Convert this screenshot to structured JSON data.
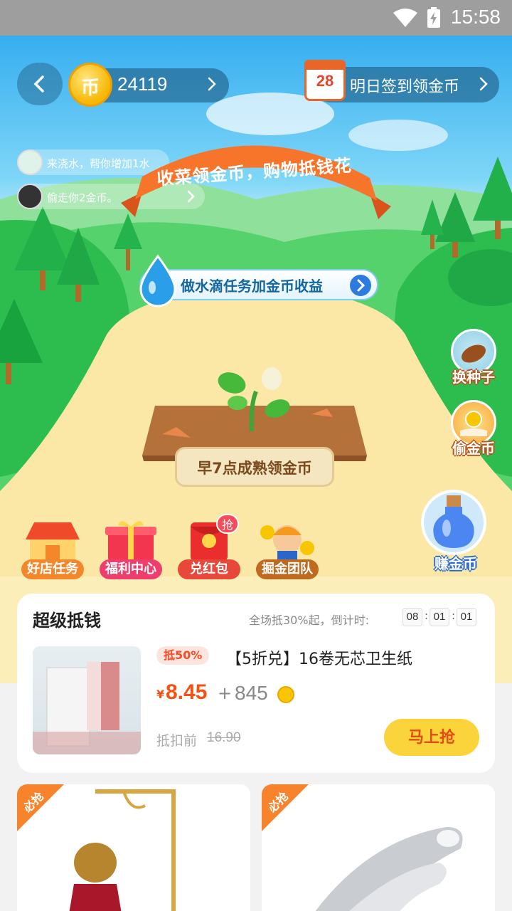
{
  "status_bar": {
    "time": "15:58",
    "icons": [
      "wifi-icon",
      "battery-charging-icon"
    ]
  },
  "header": {
    "coin_count": "24119",
    "coin_glyph": "币",
    "signin_day": "28",
    "signin_label": "明日签到领金币"
  },
  "messages": [
    {
      "text": "来浇水，帮你增加1水"
    },
    {
      "text": "偷走你2金币。"
    }
  ],
  "banner_text": "收菜领金币，购物抵钱花",
  "water_task_label": "做水滴任务加金币收益",
  "side_buttons": [
    {
      "label": "换种子",
      "icon": "seed-icon"
    },
    {
      "label": "偷金币",
      "icon": "hand-coin-icon"
    }
  ],
  "mature_label": "早7点成熟领金币",
  "features": [
    {
      "label": "好店任务",
      "color": "#f4872a",
      "icon": "shop-icon"
    },
    {
      "label": "福利中心",
      "color": "#ef3e6e",
      "icon": "gift-icon"
    },
    {
      "label": "兑红包",
      "color": "#e8483a",
      "icon": "red-envelope-icon",
      "badge": "抢"
    },
    {
      "label": "掘金团队",
      "color": "#c06a20",
      "icon": "miner-icon"
    }
  ],
  "earn_label": "赚金币",
  "deal": {
    "title": "超级抵钱",
    "countdown_label": "全场抵30%起，倒计时:",
    "countdown": [
      "08",
      "01",
      "01"
    ],
    "discount_tag": "抵50%",
    "product_name": "【5折兑】16卷无芯卫生纸",
    "price_symbol": "¥",
    "price": "8.45",
    "plus": "+",
    "coins": "845",
    "original_label": "抵扣前",
    "original_price": "16.90",
    "buy_label": "马上抢"
  },
  "tiles": [
    {
      "corner": "必抢",
      "image": "tea-kettle-stand-image"
    },
    {
      "corner": "必抢",
      "image": "chrome-stapler-image"
    }
  ]
}
